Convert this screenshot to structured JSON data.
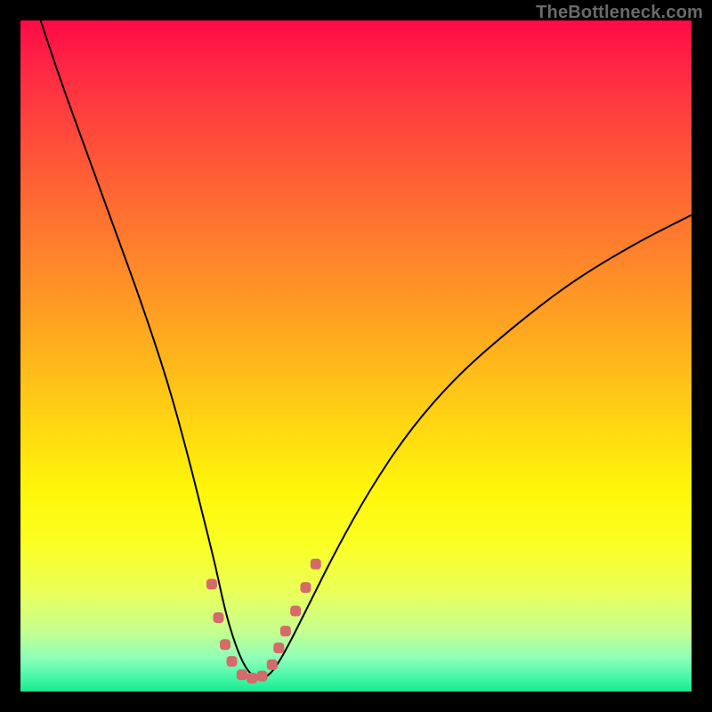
{
  "watermark": {
    "text": "TheBottleneck.com"
  },
  "chart_data": {
    "type": "line",
    "title": "",
    "xlabel": "",
    "ylabel": "",
    "xlim": [
      0,
      100
    ],
    "ylim": [
      0,
      100
    ],
    "series": [
      {
        "name": "bottleneck-curve",
        "x": [
          3,
          6,
          10,
          14,
          18,
          22,
          25,
          27,
          29,
          30.5,
          32,
          33.5,
          35,
          36.5,
          38,
          40,
          43,
          47,
          52,
          58,
          65,
          73,
          82,
          92,
          100
        ],
        "y": [
          100,
          91,
          80,
          69,
          58,
          46,
          35,
          27,
          19,
          12,
          7,
          3.5,
          2,
          2,
          3.5,
          7,
          13,
          21,
          30,
          39,
          47,
          54,
          61,
          67,
          71
        ]
      }
    ],
    "highlight": {
      "name": "optimal-zone",
      "color": "#d46a6a",
      "x": [
        28.5,
        29.5,
        30.5,
        31.5,
        33,
        34.5,
        36,
        37.5,
        38.5,
        39.5,
        41,
        42.5,
        44
      ],
      "y": [
        16,
        11,
        7,
        4.5,
        2.5,
        2,
        2.3,
        4,
        6.5,
        9,
        12,
        15.5,
        19
      ]
    },
    "background": {
      "type": "vertical-gradient",
      "stops": [
        {
          "pos": 0,
          "color": "#ff0a46"
        },
        {
          "pos": 32,
          "color": "#ff7a2e"
        },
        {
          "pos": 70,
          "color": "#fff60a"
        },
        {
          "pos": 100,
          "color": "#18e98e"
        }
      ]
    }
  }
}
